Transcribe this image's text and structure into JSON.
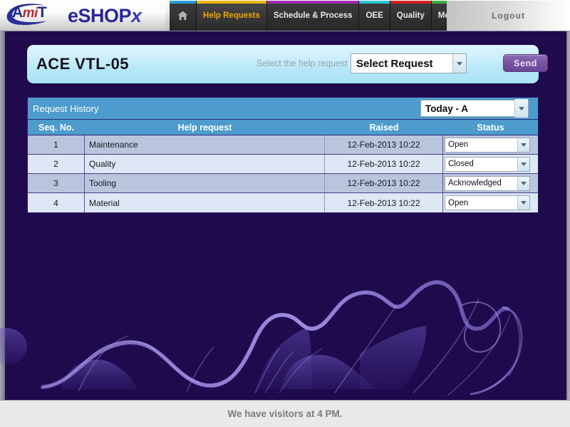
{
  "header": {
    "logo": {
      "part_a": "A",
      "part_mi": "mi",
      "part_t": "T"
    },
    "brand": "eSHOP",
    "brand_x": "x",
    "nav": [
      {
        "label": "",
        "icon": "home-icon",
        "accent": "#2e9fd4",
        "active": false,
        "name": "home"
      },
      {
        "label": "Help Requests",
        "accent": "#f0b400",
        "active": true,
        "name": "help-requests"
      },
      {
        "label": "Schedule & Process",
        "accent": "#a52bb4",
        "active": false,
        "name": "schedule-process"
      },
      {
        "label": "OEE",
        "accent": "#2ec4d8",
        "active": false,
        "name": "oee"
      },
      {
        "label": "Quality",
        "accent": "#d62020",
        "active": false,
        "name": "quality"
      },
      {
        "label": "Messages",
        "accent": "#3bb03b",
        "active": false,
        "name": "messages"
      }
    ],
    "logout_label": "Logout"
  },
  "title_panel": {
    "machine_name": "ACE VTL-05",
    "select_label": "Select the help request",
    "request_select": {
      "value": "Select Request",
      "placeholder": "Select Request"
    },
    "send_label": "Send"
  },
  "request_history": {
    "title": "Request History",
    "shift_select": {
      "value": "Today - A"
    },
    "columns": [
      "Seq. No.",
      "Help request",
      "Raised",
      "Status"
    ],
    "rows": [
      {
        "seq": "1",
        "request": "Maintenance",
        "raised": "12-Feb-2013 10:22",
        "status": "Open"
      },
      {
        "seq": "2",
        "request": "Quality",
        "raised": "12-Feb-2013 10:22",
        "status": "Closed"
      },
      {
        "seq": "3",
        "request": "Tooling",
        "raised": "12-Feb-2013 10:22",
        "status": "Acknowledged"
      },
      {
        "seq": "4",
        "request": "Material",
        "raised": "12-Feb-2013 10:22",
        "status": "Open"
      }
    ]
  },
  "footer": {
    "message": "We have visitors at 4 PM."
  },
  "colors": {
    "stage_bg": "#1e0a4d",
    "table_header": "#4d9ccd",
    "send_button": "#7a56a4",
    "row_odd": "#b9c5dd",
    "row_even": "#dde7f5",
    "active_tab_text": "#f0a800"
  }
}
